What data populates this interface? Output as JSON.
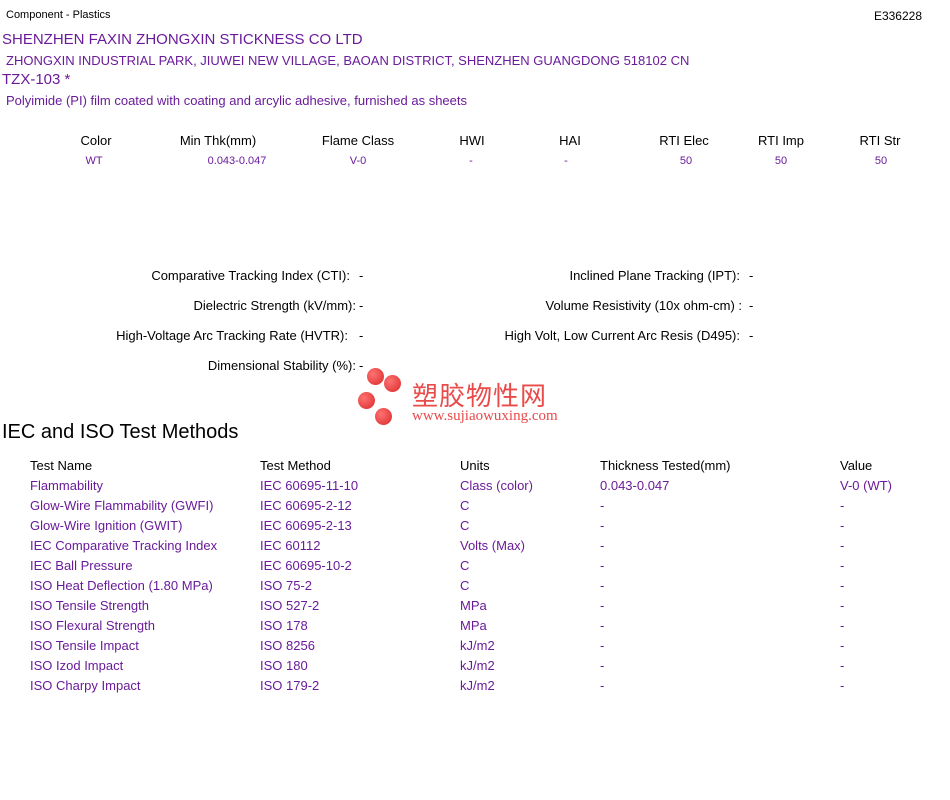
{
  "header": {
    "category": "Component - Plastics",
    "file_number": "E336228",
    "company": "SHENZHEN FAXIN ZHONGXIN STICKNESS CO LTD",
    "address": "ZHONGXIN INDUSTRIAL PARK, JIUWEI NEW VILLAGE, BAOAN DISTRICT, SHENZHEN  GUANGDONG  518102 CN",
    "product": "TZX-103  *",
    "description": "Polyimide (PI) film coated with coating and arcylic adhesive, furnished as sheets"
  },
  "properties": {
    "headers": [
      "Color",
      "Min Thk(mm)",
      "Flame Class",
      "HWI",
      "HAI",
      "RTI Elec",
      "RTI Imp",
      "RTI Str"
    ],
    "values": [
      "WT",
      "0.043-0.047",
      "V-0",
      "-",
      "-",
      "50",
      "50",
      "50"
    ]
  },
  "electrical": {
    "cti": {
      "label": "Comparative Tracking Index (CTI):",
      "value": "-"
    },
    "ipt": {
      "label": "Inclined Plane Tracking (IPT):",
      "value": "-"
    },
    "dielectric": {
      "label": "Dielectric Strength (kV/mm):",
      "value": "-"
    },
    "volume": {
      "label": "Volume Resistivity (10x ohm-cm) :",
      "value": "-"
    },
    "hvtr": {
      "label": "High-Voltage Arc Tracking Rate (HVTR):",
      "value": "-"
    },
    "d495": {
      "label": "High Volt, Low Current Arc Resis (D495):",
      "value": "-"
    },
    "dimensional": {
      "label": "Dimensional Stability (%):",
      "value": "-"
    }
  },
  "watermark": {
    "brand": "塑胶物性网",
    "url": "www.sujiaowuxing.com",
    "color": "#e84141"
  },
  "iec": {
    "title": "IEC and ISO Test Methods",
    "headers": [
      "Test Name",
      "Test Method",
      "Units",
      "Thickness Tested(mm)",
      "Value"
    ],
    "rows": [
      [
        "Flammability",
        "IEC 60695-11-10",
        "Class (color)",
        "0.043-0.047",
        "V-0 (WT)"
      ],
      [
        "Glow-Wire Flammability (GWFI)",
        "IEC 60695-2-12",
        "C",
        "-",
        "-"
      ],
      [
        "Glow-Wire Ignition (GWIT)",
        "IEC 60695-2-13",
        "C",
        "-",
        "-"
      ],
      [
        "IEC Comparative Tracking Index",
        "IEC 60112",
        "Volts (Max)",
        "-",
        "-"
      ],
      [
        "IEC Ball Pressure",
        "IEC 60695-10-2",
        "C",
        "-",
        "-"
      ],
      [
        "ISO Heat Deflection (1.80 MPa)",
        "ISO 75-2",
        "C",
        "-",
        "-"
      ],
      [
        "ISO Tensile Strength",
        "ISO 527-2",
        "MPa",
        "-",
        "-"
      ],
      [
        "ISO Flexural Strength",
        "ISO 178",
        "MPa",
        "-",
        "-"
      ],
      [
        "ISO Tensile Impact",
        "ISO 8256",
        "kJ/m2",
        "-",
        "-"
      ],
      [
        "ISO Izod Impact",
        "ISO 180",
        "kJ/m2",
        "-",
        "-"
      ],
      [
        "ISO Charpy Impact",
        "ISO 179-2",
        "kJ/m2",
        "-",
        "-"
      ]
    ]
  },
  "colors": {
    "accent": "#6a1b9a",
    "text": "#000000"
  }
}
